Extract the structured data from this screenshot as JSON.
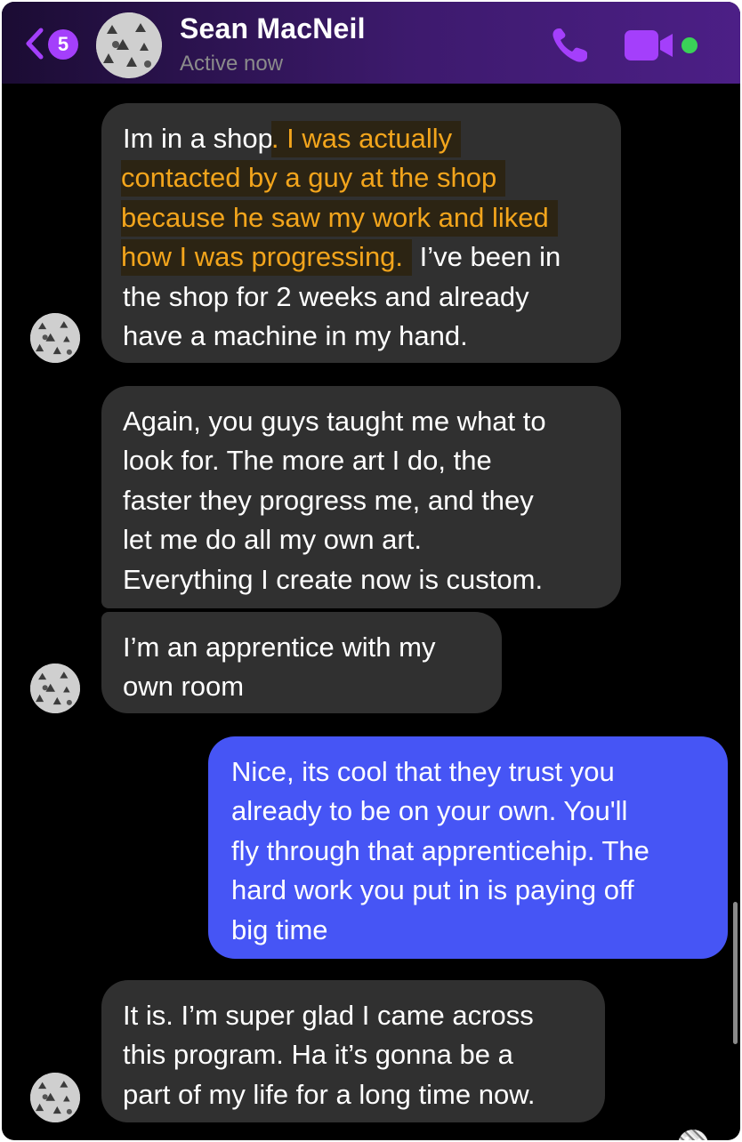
{
  "header": {
    "back_badge_count": "5",
    "contact_name": "Sean MacNeil",
    "status": "Active now",
    "call_icon": "phone-icon",
    "video_icon": "video-camera-icon",
    "accent_color": "#a43ffb",
    "online_color": "#3ad158"
  },
  "messages": [
    {
      "direction": "incoming",
      "lines": [
        {
          "pre": "Im in a shop",
          "hl": ". I was actually",
          "post": ""
        },
        {
          "pre": "",
          "hl": "contacted by a guy at the shop",
          "post": ""
        },
        {
          "pre": "",
          "hl": "because he saw my work and liked",
          "post": ""
        },
        {
          "pre": "",
          "hl": "how I was progressing.",
          "post": " I’ve been in"
        },
        {
          "pre": "the shop for 2 weeks and already",
          "hl": "",
          "post": ""
        },
        {
          "pre": "have a machine in my hand.",
          "hl": "",
          "post": ""
        }
      ]
    },
    {
      "direction": "incoming",
      "lines": [
        "Again, you guys taught me what to",
        "look for. The more art I do, the",
        "faster they progress me, and they",
        "let me do all my own art.",
        "Everything I create now is custom."
      ]
    },
    {
      "direction": "incoming",
      "lines": [
        "I’m an apprentice with my",
        "own room"
      ]
    },
    {
      "direction": "outgoing",
      "lines": [
        "Nice, its cool that they trust you",
        "already to be on your own. You'll",
        "fly through that apprenticehip. The",
        "hard work you put in is paying off",
        "big time"
      ]
    },
    {
      "direction": "incoming",
      "lines": [
        "It is. I’m super glad I came across",
        "this program. Ha it’s gonna be a",
        "part of my life for a long time now."
      ]
    }
  ],
  "colors": {
    "incoming_bubble": "#303030",
    "outgoing_bubble": "#4655f5",
    "highlight_text": "#f3a51c"
  }
}
